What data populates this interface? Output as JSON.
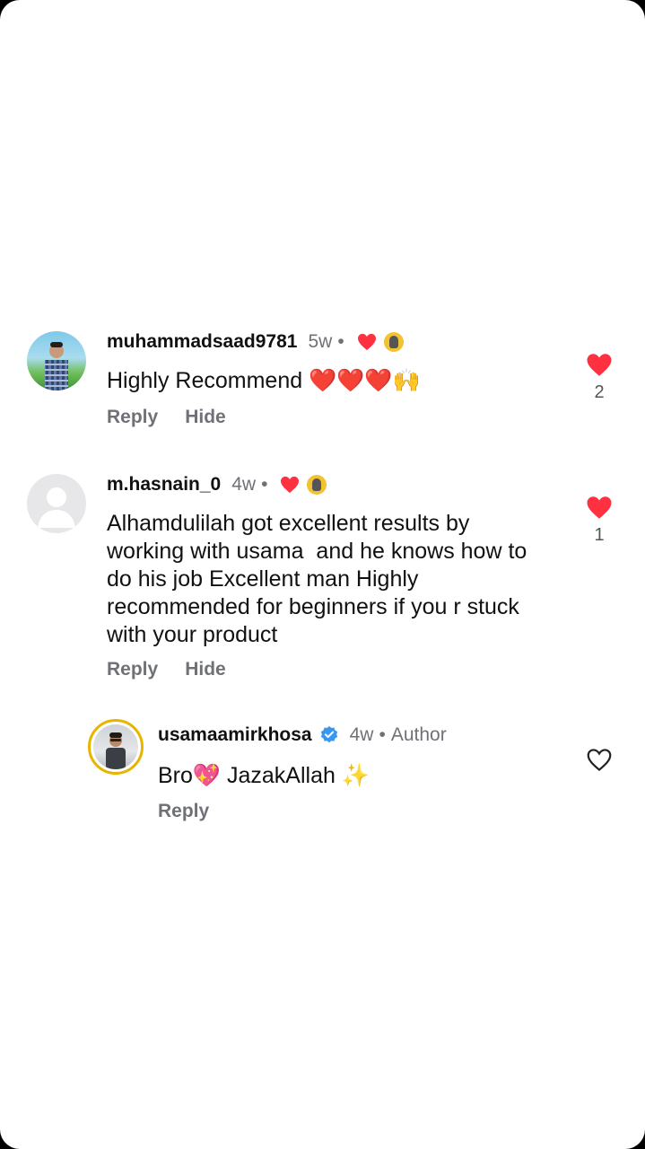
{
  "comments": [
    {
      "username": "muhammadsaad9781",
      "time": "5w",
      "text": "Highly Recommend ❤️❤️❤️🙌",
      "actions": {
        "reply": "Reply",
        "hide": "Hide"
      },
      "like_count": "2",
      "liked": true,
      "creator_liked": true
    },
    {
      "username": "m.hasnain_0",
      "time": "4w",
      "text": "Alhamdulilah got excellent results by\nworking with usama  and he knows how to\ndo his job Excellent man Highly\nrecommended for beginners if you r stuck\nwith your product",
      "actions": {
        "reply": "Reply",
        "hide": "Hide"
      },
      "like_count": "1",
      "liked": true,
      "creator_liked": true
    }
  ],
  "reply": {
    "username": "usamaamirkhosa",
    "verified": true,
    "time": "4w",
    "author_label": "Author",
    "text": "Bro💖 JazakAllah ✨",
    "actions": {
      "reply": "Reply"
    },
    "liked": false
  },
  "colors": {
    "like_red": "#ff3040",
    "verified_blue": "#3897f0",
    "secondary_text": "#6f7176"
  },
  "icons": {
    "like": "heart-icon",
    "unliked": "heart-outline-icon",
    "verified": "verified-badge-icon"
  }
}
